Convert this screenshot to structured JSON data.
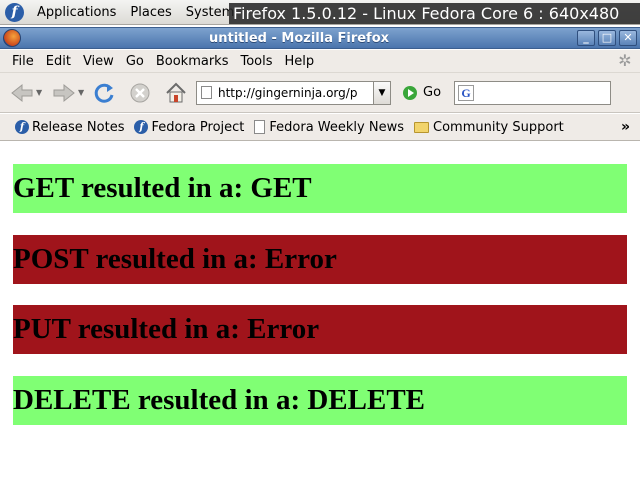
{
  "panel": {
    "menus": [
      "Applications",
      "Places",
      "System"
    ],
    "overlay_title": "Firefox 1.5.0.12 - Linux Fedora Core 6 : 640x480"
  },
  "window": {
    "title": "untitled - Mozilla Firefox"
  },
  "menubar": {
    "items": [
      "File",
      "Edit",
      "View",
      "Go",
      "Bookmarks",
      "Tools",
      "Help"
    ]
  },
  "navbar": {
    "url": "http://gingerninja.org/p",
    "go_label": "Go",
    "search_value": ""
  },
  "bookmarks": {
    "items": [
      "Release Notes",
      "Fedora Project",
      "Fedora Weekly News",
      "Community Support"
    ],
    "more": "»"
  },
  "results": [
    {
      "text": "GET resulted in a: GET",
      "color": "#80ff74"
    },
    {
      "text": "POST resulted in a: Error",
      "color": "#a0141b"
    },
    {
      "text": "PUT resulted in a: Error",
      "color": "#a0141b"
    },
    {
      "text": "DELETE resulted in a: DELETE",
      "color": "#80ff74"
    }
  ]
}
